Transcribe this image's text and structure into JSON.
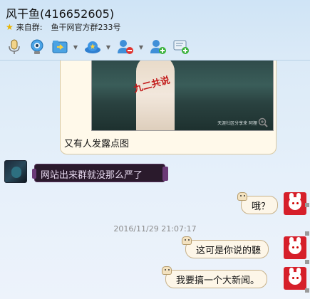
{
  "window": {
    "title": "风干鱼(416652605)",
    "source_prefix": "来自群:",
    "source_group": "鱼干网官方群233号"
  },
  "toolbar": {
    "buttons": [
      {
        "name": "voice-button",
        "icon": "microphone-icon"
      },
      {
        "name": "video-button",
        "icon": "webcam-icon"
      },
      {
        "name": "send-file-button",
        "icon": "folder-send-icon"
      },
      {
        "name": "remote-assist-button",
        "icon": "hat-icon"
      },
      {
        "name": "block-user-button",
        "icon": "user-remove-icon"
      },
      {
        "name": "add-friend-button",
        "icon": "user-add-icon"
      },
      {
        "name": "message-button",
        "icon": "message-plus-icon"
      }
    ]
  },
  "messages": {
    "image_caption": "又有人发露点图",
    "image_overlay_text": "九二共说",
    "image_stamp": "天涯社区分享来 阿狸",
    "left_message": "网站出来群就没那么严了",
    "right_1": "哦？",
    "timestamp": "2016/11/29 21:07:17",
    "right_2": "这可是你说的聽",
    "right_3": "我要搞一个大新闻。"
  },
  "colors": {
    "accent": "#2a82d0",
    "bubble_right": "#fdf6e8",
    "bubble_dark": "#2a1a2c",
    "avatar_right": "#d61f2a"
  }
}
